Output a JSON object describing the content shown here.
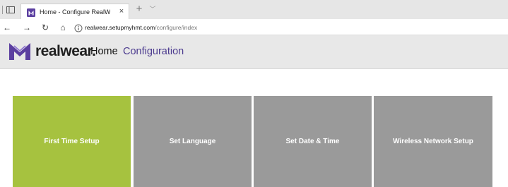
{
  "browser": {
    "tab": {
      "title": "Home - Configure RealW",
      "close_glyph": "×"
    },
    "new_tab_glyph": "+",
    "tab_list_glyph": "﹀",
    "nav": {
      "back_glyph": "←",
      "forward_glyph": "→",
      "reload_glyph": "↻",
      "home_glyph": "⌂"
    },
    "address": {
      "host": "realwear.setupmyhmt.com",
      "path": "/configure/index"
    }
  },
  "site": {
    "logo_text": "realwear.",
    "nav": {
      "home": "Home",
      "configuration": "Configuration"
    },
    "colors": {
      "brand_purple": "#5b3fa0",
      "config_link": "#4b3a8e",
      "tile_active": "#a6c23f",
      "tile_default": "#9a9a9a"
    },
    "tiles": [
      {
        "label": "First Time Setup"
      },
      {
        "label": "Set Language"
      },
      {
        "label": "Set Date & Time"
      },
      {
        "label": "Wireless Network Setup"
      }
    ]
  }
}
